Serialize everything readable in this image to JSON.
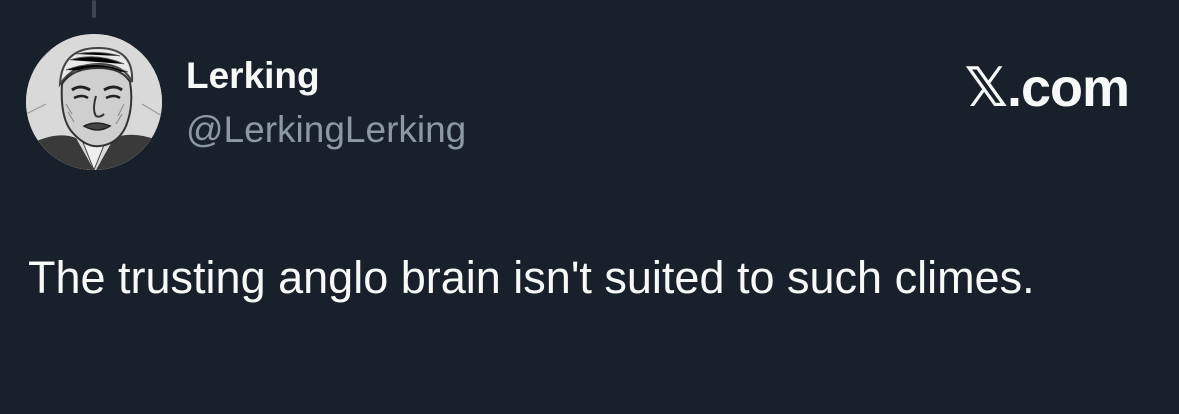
{
  "tweet": {
    "author": {
      "display_name": "Lerking",
      "handle": "@LerkingLerking",
      "avatar_icon": "sketched-portrait-avatar"
    },
    "brand": "𝕏.com",
    "text": "The trusting anglo brain isn't suited to such climes."
  },
  "colors": {
    "background": "#18202b",
    "primary_text": "#f7f9f9",
    "secondary_text": "#8b98a5"
  }
}
